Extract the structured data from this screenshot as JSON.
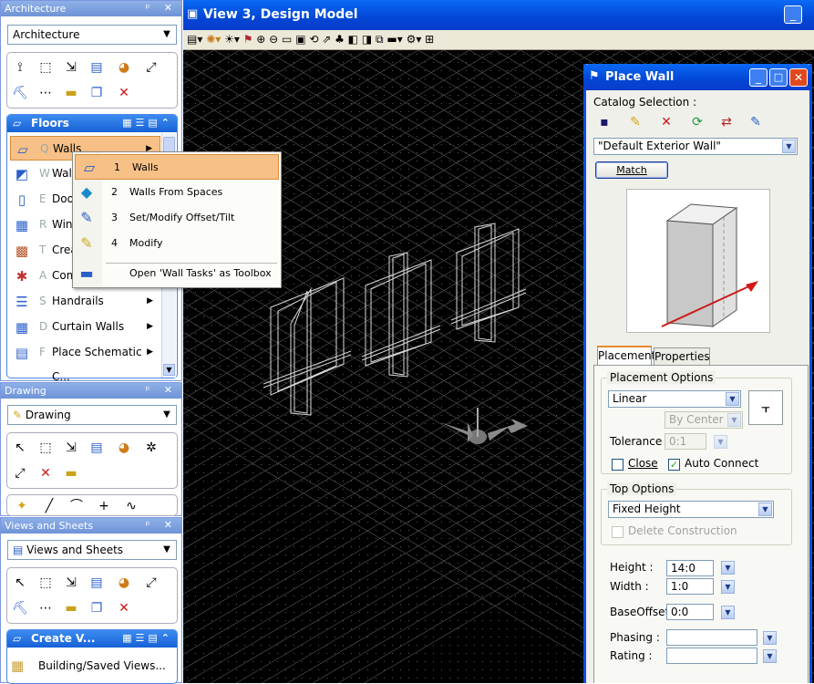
{
  "colors": {
    "title_blue": "#0a3dca",
    "accent_orange": "#f7c087",
    "viewport_bg": "#000000"
  },
  "left": {
    "arch": {
      "header": "Architecture",
      "combo": "Architecture",
      "tools_row1": [
        "place-element-icon",
        "select-icon",
        "move-icon",
        "measure-icon",
        "palette-icon",
        "resize-icon"
      ],
      "tools_row2": [
        "paint-icon",
        "align-icon",
        "ruler-icon",
        "copy-icon",
        "delete-icon"
      ],
      "task_title": "Floors",
      "items": [
        {
          "key": "Q",
          "label": "Walls",
          "icon": "wall-icon"
        },
        {
          "key": "W",
          "label": "Wall",
          "icon": "wall-join-icon"
        },
        {
          "key": "E",
          "label": "Door",
          "icon": "door-icon"
        },
        {
          "key": "R",
          "label": "Wind",
          "icon": "window-icon"
        },
        {
          "key": "T",
          "label": "Crea",
          "icon": "create-icon"
        },
        {
          "key": "A",
          "label": "Com",
          "icon": "component-icon"
        },
        {
          "key": "S",
          "label": "Handrails",
          "icon": "handrail-icon"
        },
        {
          "key": "D",
          "label": "Curtain Walls",
          "icon": "curtain-wall-icon"
        },
        {
          "key": "F",
          "label": "Place Schematic C...",
          "icon": "schematic-icon"
        }
      ]
    },
    "drawing": {
      "header": "Drawing",
      "combo": "Drawing"
    },
    "views": {
      "header": "Views and Sheets",
      "combo": "Views and Sheets",
      "task_title": "Create V...",
      "item": "Building/Saved Views..."
    }
  },
  "menu": {
    "items": [
      {
        "num": "1",
        "label": "Walls"
      },
      {
        "num": "2",
        "label": "Walls From Spaces"
      },
      {
        "num": "3",
        "label": "Set/Modify Offset/Tilt"
      },
      {
        "num": "4",
        "label": "Modify"
      }
    ],
    "open_toolbox": "Open 'Wall Tasks' as Toolbox"
  },
  "view": {
    "title": "View 3, Design Model"
  },
  "place_wall": {
    "title": "Place Wall",
    "catalog_label": "Catalog Selection :",
    "catalog_value": "\"Default Exterior Wall\"",
    "match": "Match",
    "tabs": [
      "Placement",
      "Properties"
    ],
    "placement_options": "Placement Options",
    "mode": "Linear",
    "align": "By Center",
    "tolerance_label": "Tolerance :",
    "tolerance": "0:1",
    "close": "Close",
    "auto_connect": "Auto Connect",
    "auto_connect_checked": true,
    "top_options": "Top Options",
    "top_mode": "Fixed Height",
    "delete_construction": "Delete Construction",
    "height_label": "Height :",
    "height": "14:0",
    "width_label": "Width :",
    "width": "1:0",
    "base_offset_label": "BaseOffset :",
    "base_offset": "0:0",
    "phasing_label": "Phasing :",
    "rating_label": "Rating :"
  }
}
